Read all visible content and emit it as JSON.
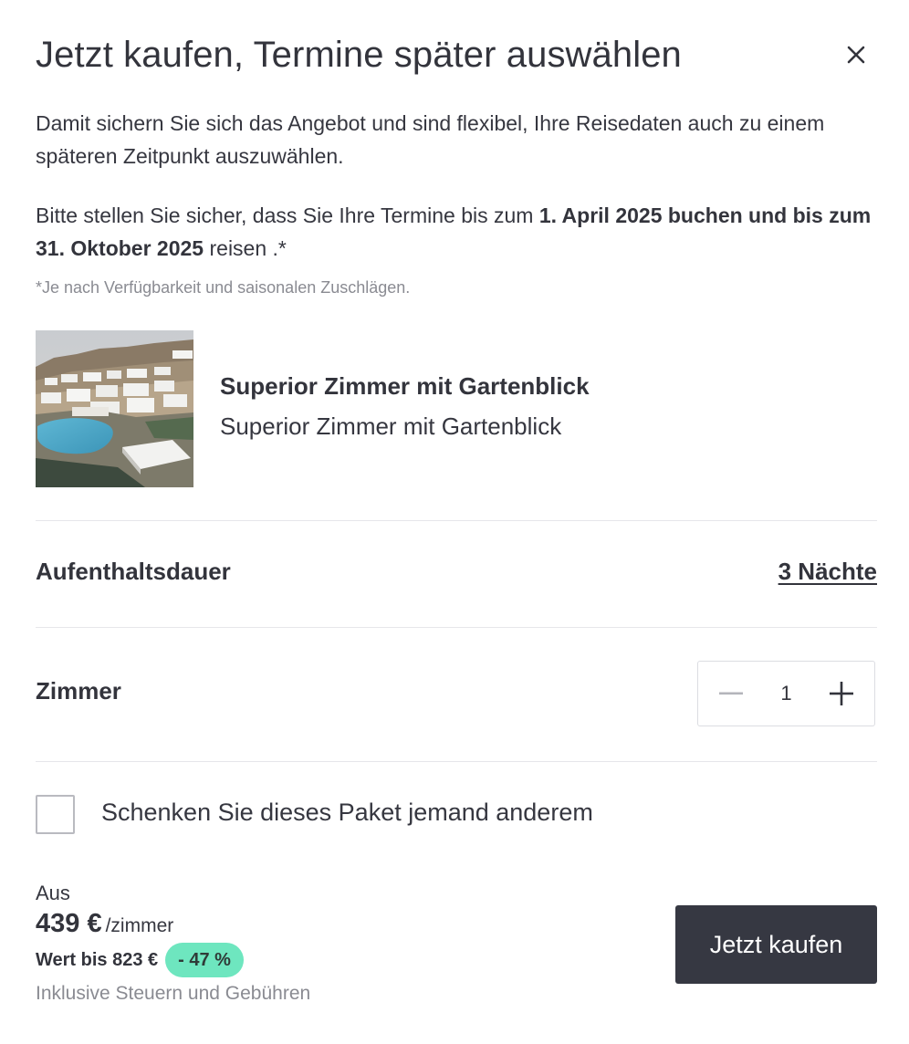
{
  "dialog": {
    "title": "Jetzt kaufen, Termine später auswählen",
    "close_icon": "close-icon",
    "intro": "Damit sichern Sie sich das Angebot und sind flexibel, Ihre Reisedaten auch zu einem späteren Zeitpunkt auszuwählen.",
    "notice": {
      "prefix": "Bitte stellen Sie sicher, dass Sie Ihre Termine bis zum ",
      "booking_deadline": "1. April 2025 buchen und bis zum 31. Oktober 2025",
      "suffix": " reisen .*"
    },
    "footnote": "*Je nach Verfügbarkeit und saisonalen Zuschlägen."
  },
  "room": {
    "image": "hotel-resort-photo",
    "title": "Superior Zimmer mit Gartenblick",
    "subtitle": "Superior Zimmer mit Gartenblick"
  },
  "stay": {
    "label": "Aufenthaltsdauer",
    "value": "3 Nächte"
  },
  "rooms": {
    "label": "Zimmer",
    "quantity": "1",
    "decrement_icon": "minus-icon",
    "increment_icon": "plus-icon"
  },
  "gift": {
    "checked": false,
    "label": "Schenken Sie dieses Paket jemand anderem"
  },
  "pricing": {
    "from_label": "Aus",
    "price": "439 €",
    "per_unit": "/zimmer",
    "value_label": "Wert bis 823 €",
    "discount": "- 47 %",
    "taxes_note": "Inklusive Steuern und Gebühren"
  },
  "cta": {
    "label": "Jetzt kaufen"
  },
  "colors": {
    "text": "#363740",
    "muted": "#8a8b92",
    "button_bg": "#363842",
    "badge_bg": "#6ee6bf",
    "divider": "#e6e6ea"
  }
}
